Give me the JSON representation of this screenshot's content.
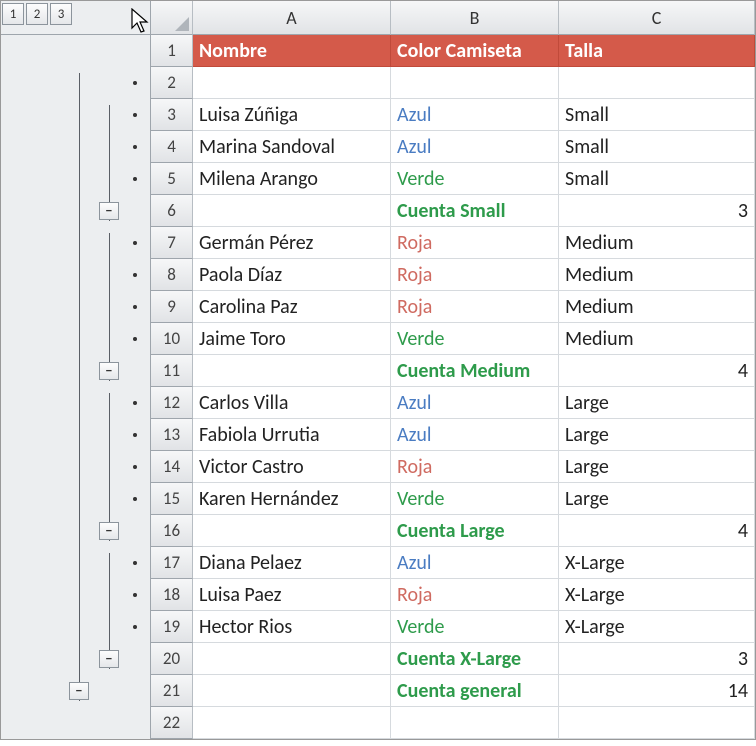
{
  "outline": {
    "levels": [
      "1",
      "2",
      "3"
    ],
    "rows": [
      {
        "r": 1,
        "marks": []
      },
      {
        "r": 2,
        "marks": [
          {
            "col": 3,
            "kind": "dot"
          }
        ]
      },
      {
        "r": 3,
        "marks": [
          {
            "col": 3,
            "kind": "dot"
          }
        ]
      },
      {
        "r": 4,
        "marks": [
          {
            "col": 3,
            "kind": "dot"
          }
        ]
      },
      {
        "r": 5,
        "marks": [
          {
            "col": 3,
            "kind": "dot"
          }
        ]
      },
      {
        "r": 6,
        "marks": [
          {
            "col": 2,
            "kind": "minus"
          }
        ]
      },
      {
        "r": 7,
        "marks": [
          {
            "col": 3,
            "kind": "dot"
          }
        ]
      },
      {
        "r": 8,
        "marks": [
          {
            "col": 3,
            "kind": "dot"
          }
        ]
      },
      {
        "r": 9,
        "marks": [
          {
            "col": 3,
            "kind": "dot"
          }
        ]
      },
      {
        "r": 10,
        "marks": [
          {
            "col": 3,
            "kind": "dot"
          }
        ]
      },
      {
        "r": 11,
        "marks": [
          {
            "col": 2,
            "kind": "minus"
          }
        ]
      },
      {
        "r": 12,
        "marks": [
          {
            "col": 3,
            "kind": "dot"
          }
        ]
      },
      {
        "r": 13,
        "marks": [
          {
            "col": 3,
            "kind": "dot"
          }
        ]
      },
      {
        "r": 14,
        "marks": [
          {
            "col": 3,
            "kind": "dot"
          }
        ]
      },
      {
        "r": 15,
        "marks": [
          {
            "col": 3,
            "kind": "dot"
          }
        ]
      },
      {
        "r": 16,
        "marks": [
          {
            "col": 2,
            "kind": "minus"
          }
        ]
      },
      {
        "r": 17,
        "marks": [
          {
            "col": 3,
            "kind": "dot"
          }
        ]
      },
      {
        "r": 18,
        "marks": [
          {
            "col": 3,
            "kind": "dot"
          }
        ]
      },
      {
        "r": 19,
        "marks": [
          {
            "col": 3,
            "kind": "dot"
          }
        ]
      },
      {
        "r": 20,
        "marks": [
          {
            "col": 2,
            "kind": "minus"
          }
        ]
      },
      {
        "r": 21,
        "marks": [
          {
            "col": 1,
            "kind": "minus"
          }
        ]
      },
      {
        "r": 22,
        "marks": []
      }
    ]
  },
  "columns": {
    "A": "A",
    "B": "B",
    "C": "C"
  },
  "header": {
    "A": "Nombre",
    "B": "Color Camiseta",
    "C": "Talla"
  },
  "row_labels": [
    "1",
    "2",
    "3",
    "4",
    "5",
    "6",
    "7",
    "8",
    "9",
    "10",
    "11",
    "12",
    "13",
    "14",
    "15",
    "16",
    "17",
    "18",
    "19",
    "20",
    "21",
    "22"
  ],
  "data": [
    {
      "r": 2,
      "A": "",
      "B": "",
      "C": "",
      "bcls": ""
    },
    {
      "r": 3,
      "A": "Luisa Zúñiga",
      "B": "Azul",
      "C": "Small",
      "bcls": "c-azul"
    },
    {
      "r": 4,
      "A": "Marina Sandoval",
      "B": "Azul",
      "C": "Small",
      "bcls": "c-azul"
    },
    {
      "r": 5,
      "A": "Milena Arango",
      "B": "Verde",
      "C": "Small",
      "bcls": "c-verde"
    },
    {
      "r": 6,
      "A": "",
      "B": "Cuenta Small",
      "C": "3",
      "bcls": "c-sum",
      "sum": true
    },
    {
      "r": 7,
      "A": "Germán Pérez",
      "B": "Roja",
      "C": "Medium",
      "bcls": "c-roja"
    },
    {
      "r": 8,
      "A": "Paola Díaz",
      "B": "Roja",
      "C": "Medium",
      "bcls": "c-roja"
    },
    {
      "r": 9,
      "A": "Carolina Paz",
      "B": "Roja",
      "C": "Medium",
      "bcls": "c-roja"
    },
    {
      "r": 10,
      "A": "Jaime Toro",
      "B": "Verde",
      "C": "Medium",
      "bcls": "c-verde"
    },
    {
      "r": 11,
      "A": "",
      "B": "Cuenta Medium",
      "C": "4",
      "bcls": "c-sum",
      "sum": true
    },
    {
      "r": 12,
      "A": "Carlos Villa",
      "B": "Azul",
      "C": "Large",
      "bcls": "c-azul"
    },
    {
      "r": 13,
      "A": "Fabiola Urrutia",
      "B": "Azul",
      "C": "Large",
      "bcls": "c-azul"
    },
    {
      "r": 14,
      "A": "Victor Castro",
      "B": "Roja",
      "C": "Large",
      "bcls": "c-roja"
    },
    {
      "r": 15,
      "A": "Karen Hernández",
      "B": "Verde",
      "C": "Large",
      "bcls": "c-verde"
    },
    {
      "r": 16,
      "A": "",
      "B": "Cuenta Large",
      "C": "4",
      "bcls": "c-sum",
      "sum": true
    },
    {
      "r": 17,
      "A": "Diana Pelaez",
      "B": "Azul",
      "C": "X-Large",
      "bcls": "c-azul"
    },
    {
      "r": 18,
      "A": "Luisa Paez",
      "B": "Roja",
      "C": "X-Large",
      "bcls": "c-roja"
    },
    {
      "r": 19,
      "A": "Hector Rios",
      "B": "Verde",
      "C": "X-Large",
      "bcls": "c-verde"
    },
    {
      "r": 20,
      "A": "",
      "B": "Cuenta X-Large",
      "C": "3",
      "bcls": "c-sum",
      "sum": true
    },
    {
      "r": 21,
      "A": "",
      "B": "Cuenta general",
      "C": "14",
      "bcls": "c-sum",
      "sum": true
    },
    {
      "r": 22,
      "A": "",
      "B": "",
      "C": "",
      "bcls": ""
    }
  ],
  "chart_data": {
    "type": "table",
    "columns": [
      "Nombre",
      "Color Camiseta",
      "Talla"
    ],
    "rows": [
      [
        "Luisa Zúñiga",
        "Azul",
        "Small"
      ],
      [
        "Marina Sandoval",
        "Azul",
        "Small"
      ],
      [
        "Milena Arango",
        "Verde",
        "Small"
      ],
      [
        "Germán Pérez",
        "Roja",
        "Medium"
      ],
      [
        "Paola Díaz",
        "Roja",
        "Medium"
      ],
      [
        "Carolina Paz",
        "Roja",
        "Medium"
      ],
      [
        "Jaime Toro",
        "Verde",
        "Medium"
      ],
      [
        "Carlos Villa",
        "Azul",
        "Large"
      ],
      [
        "Fabiola Urrutia",
        "Azul",
        "Large"
      ],
      [
        "Victor Castro",
        "Roja",
        "Large"
      ],
      [
        "Karen Hernández",
        "Verde",
        "Large"
      ],
      [
        "Diana Pelaez",
        "Azul",
        "X-Large"
      ],
      [
        "Luisa Paez",
        "Roja",
        "X-Large"
      ],
      [
        "Hector Rios",
        "Verde",
        "X-Large"
      ]
    ],
    "subtotals": [
      {
        "label": "Cuenta Small",
        "value": 3
      },
      {
        "label": "Cuenta Medium",
        "value": 4
      },
      {
        "label": "Cuenta Large",
        "value": 4
      },
      {
        "label": "Cuenta X-Large",
        "value": 3
      },
      {
        "label": "Cuenta general",
        "value": 14
      }
    ]
  }
}
